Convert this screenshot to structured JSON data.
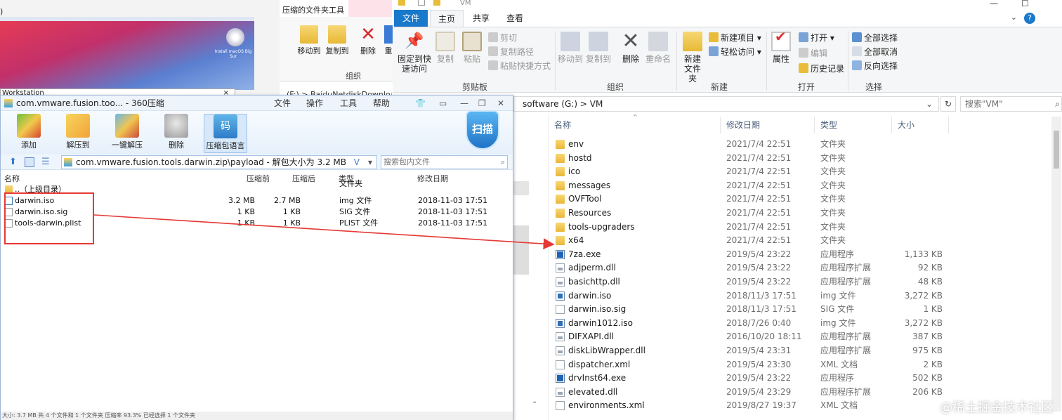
{
  "bg_window": {
    "install_label": "Install macOS Big Sur",
    "workstation_label": "Workstation",
    "close_glyph": "×",
    "paren_glyph": ")"
  },
  "bg_mid": {
    "context_tab": "压缩的文件夹工具",
    "move_to": "移动到",
    "copy_to": "复制到",
    "delete": "删除",
    "rename_cut": "重",
    "group": "组织",
    "path_fragment": "(F:) > BaiduNetdiskDownload"
  },
  "explorer": {
    "title": "VM",
    "tabs": {
      "file": "文件",
      "home": "主页",
      "share": "共享",
      "view": "查看"
    },
    "help": "?",
    "ribbon": {
      "pin_quick": "固定到快速访问",
      "copy": "复制",
      "paste": "粘贴",
      "cut": "剪切",
      "copy_path": "复制路径",
      "paste_shortcut": "粘贴快捷方式",
      "clipboard_group": "剪贴板",
      "move_to": "移动到",
      "copy_to": "复制到",
      "delete": "删除",
      "rename": "重命名",
      "organize_group": "组织",
      "new_folder": "新建文件夹",
      "new_item": "新建项目",
      "easy_access": "轻松访问",
      "new_group": "新建",
      "properties": "属性",
      "open": "打开",
      "edit": "编辑",
      "history": "历史记录",
      "open_group": "打开",
      "select_all": "全部选择",
      "select_none": "全部取消",
      "invert_selection": "反向选择",
      "select_group": "选择"
    },
    "address": "software (G:)  >  VM",
    "search_placeholder": "搜索\"VM\"",
    "columns": {
      "name": "名称",
      "date": "修改日期",
      "type": "类型",
      "size": "大小"
    },
    "files": [
      {
        "name": "env",
        "date": "2021/7/4 22:51",
        "type": "文件夹",
        "size": "",
        "icon": "folder"
      },
      {
        "name": "hostd",
        "date": "2021/7/4 22:51",
        "type": "文件夹",
        "size": "",
        "icon": "folder"
      },
      {
        "name": "ico",
        "date": "2021/7/4 22:51",
        "type": "文件夹",
        "size": "",
        "icon": "folder"
      },
      {
        "name": "messages",
        "date": "2021/7/4 22:51",
        "type": "文件夹",
        "size": "",
        "icon": "folder"
      },
      {
        "name": "OVFTool",
        "date": "2021/7/4 22:51",
        "type": "文件夹",
        "size": "",
        "icon": "folder"
      },
      {
        "name": "Resources",
        "date": "2021/7/4 22:51",
        "type": "文件夹",
        "size": "",
        "icon": "folder"
      },
      {
        "name": "tools-upgraders",
        "date": "2021/7/4 22:51",
        "type": "文件夹",
        "size": "",
        "icon": "folder"
      },
      {
        "name": "x64",
        "date": "2021/7/4 22:51",
        "type": "文件夹",
        "size": "",
        "icon": "folder"
      },
      {
        "name": "7za.exe",
        "date": "2019/5/4 23:22",
        "type": "应用程序",
        "size": "1,133 KB",
        "icon": "exe"
      },
      {
        "name": "adjperm.dll",
        "date": "2019/5/4 23:22",
        "type": "应用程序扩展",
        "size": "92 KB",
        "icon": "dll"
      },
      {
        "name": "basichttp.dll",
        "date": "2019/5/4 23:22",
        "type": "应用程序扩展",
        "size": "48 KB",
        "icon": "dll"
      },
      {
        "name": "darwin.iso",
        "date": "2018/11/3 17:51",
        "type": "img 文件",
        "size": "3,272 KB",
        "icon": "iso"
      },
      {
        "name": "darwin.iso.sig",
        "date": "2018/11/3 17:51",
        "type": "SIG 文件",
        "size": "1 KB",
        "icon": "file"
      },
      {
        "name": "darwin1012.iso",
        "date": "2018/7/26 0:40",
        "type": "img 文件",
        "size": "3,272 KB",
        "icon": "iso"
      },
      {
        "name": "DIFXAPI.dll",
        "date": "2016/10/20 18:11",
        "type": "应用程序扩展",
        "size": "387 KB",
        "icon": "dll"
      },
      {
        "name": "diskLibWrapper.dll",
        "date": "2019/5/4 23:31",
        "type": "应用程序扩展",
        "size": "975 KB",
        "icon": "dll"
      },
      {
        "name": "dispatcher.xml",
        "date": "2019/5/4 23:30",
        "type": "XML 文档",
        "size": "2 KB",
        "icon": "file"
      },
      {
        "name": "drvInst64.exe",
        "date": "2019/5/4 23:22",
        "type": "应用程序",
        "size": "502 KB",
        "icon": "exe"
      },
      {
        "name": "elevated.dll",
        "date": "2019/5/4 23:29",
        "type": "应用程序扩展",
        "size": "206 KB",
        "icon": "dll"
      },
      {
        "name": "environments.xml",
        "date": "2019/8/27 19:37",
        "type": "XML 文档",
        "size": "",
        "icon": "file"
      }
    ]
  },
  "zip": {
    "title": "com.vmware.fusion.too... - 360压缩",
    "menu": {
      "file": "文件",
      "ops": "操作",
      "tools": "工具",
      "help": "帮助"
    },
    "toolbar": {
      "add": "添加",
      "extract": "解压到",
      "one_click": "一键解压",
      "delete": "删除",
      "lang": "压缩包语言",
      "lang_icon": "码",
      "scan": "扫描"
    },
    "path": "com.vmware.fusion.tools.darwin.zip\\payload - 解包大小为 3.2 MB",
    "search_placeholder": "搜索包内文件",
    "columns": {
      "name": "名称",
      "before": "压缩前",
      "after": "压缩后",
      "type": "类型",
      "date": "修改日期"
    },
    "rows": [
      {
        "name": "..（上级目录）",
        "before": "",
        "after": "",
        "type": "文件夹",
        "date": "",
        "icon": "up"
      },
      {
        "name": "darwin.iso",
        "before": "3.2 MB",
        "after": "2.7 MB",
        "type": "img 文件",
        "date": "2018-11-03 17:51",
        "icon": "iso"
      },
      {
        "name": "darwin.iso.sig",
        "before": "1 KB",
        "after": "1 KB",
        "type": "SIG 文件",
        "date": "2018-11-03 17:51",
        "icon": "txt"
      },
      {
        "name": "tools-darwin.plist",
        "before": "1 KB",
        "after": "1 KB",
        "type": "PLIST 文件",
        "date": "2018-11-03 17:51",
        "icon": "txt"
      }
    ],
    "status": "大小: 3.7 MB 共 4 个文件和 1 个文件夹 压缩率 93.3% 已经选择 1 个文件夹"
  },
  "watermark": "@稀土掘金技术社区",
  "colors": {
    "accent": "#1979ca",
    "annotation": "#e53935"
  }
}
